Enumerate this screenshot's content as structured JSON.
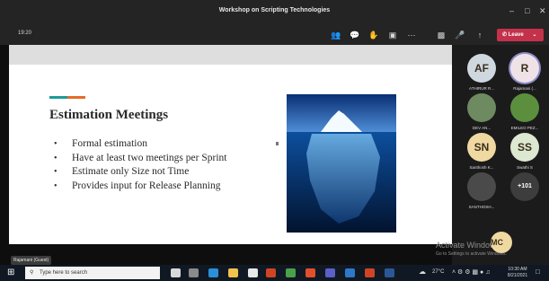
{
  "window": {
    "title": "Workshop on Scripting Technologies"
  },
  "toolbar": {
    "time": "19:20",
    "leave_label": "Leave"
  },
  "slide": {
    "title": "Estimation Meetings",
    "bullets": [
      "Formal estimation",
      "Have at least two meetings per Sprint",
      "Estimate only Size not Time",
      "Provides input for Release Planning"
    ]
  },
  "presenter": {
    "name_tag": "Rajamani (Guest)"
  },
  "participants": [
    {
      "initials": "AF",
      "name": "ATHIRUR R...",
      "color": "#cfd7df"
    },
    {
      "initials": "R",
      "name": "Rajamani (...",
      "color": "#f0e3e8"
    },
    {
      "initials": "",
      "name": "DEV AN...",
      "color": "#6e8a60"
    },
    {
      "initials": "",
      "name": "EMILEO PEZ...",
      "color": "#5b8f3e"
    },
    {
      "initials": "SN",
      "name": "Santhosh K...",
      "color": "#efd9a1"
    },
    {
      "initials": "SS",
      "name": "Swathi S",
      "color": "#dce8d0"
    },
    {
      "initials": "",
      "name": "SANTHOSH...",
      "color": "#4a4a4a"
    },
    {
      "initials": "+101",
      "name": "",
      "color": "#3d3d3d"
    }
  ],
  "floating_avatar": {
    "initials": "MC",
    "color": "#efd9a1"
  },
  "watermark": {
    "title": "Activate Windows",
    "subtitle": "Go to Settings to activate Windows."
  },
  "taskbar": {
    "search_placeholder": "Type here to search",
    "weather": "27°C",
    "clock_time": "10:30 AM",
    "clock_date": "8/21/2021"
  }
}
